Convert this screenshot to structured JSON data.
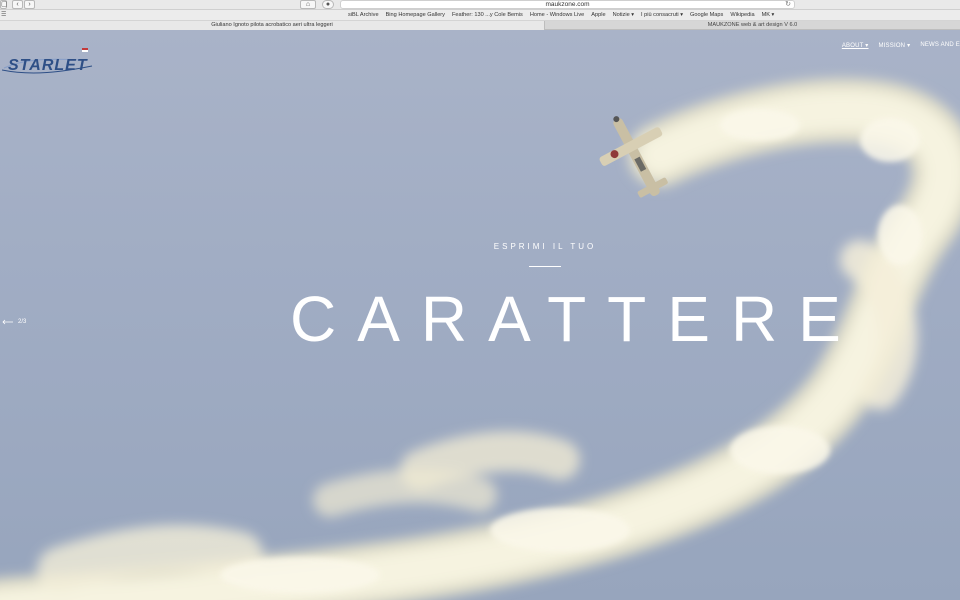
{
  "browser": {
    "url": "maukzone.com",
    "bookmarks": [
      "siBL Archive",
      "Bing Homepage Gallery",
      "Feather: 130 ...y Cole Bemis",
      "Home - Windows Live",
      "Apple",
      "Notizie ▾",
      "I più consacruti ▾",
      "Google Maps",
      "Wikipedia",
      "MK ▾"
    ],
    "tabs": [
      {
        "label": "Giuliano Ignoto pilota acrobatico aeri ultra leggeri"
      },
      {
        "label": "MAUKZONE web & art design V 6.0"
      }
    ]
  },
  "site": {
    "nav": [
      "ABOUT ▾",
      "MISSION ▾",
      "NEWS AND E"
    ],
    "hero": {
      "subtitle": "ESPRIMI IL TUO",
      "title": "CARATTERE"
    },
    "slide_counter": "2/3"
  },
  "colors": {
    "sky": "#a1adc4",
    "smoke": "#f4f0da",
    "logo_blue": "#2e4f86"
  }
}
